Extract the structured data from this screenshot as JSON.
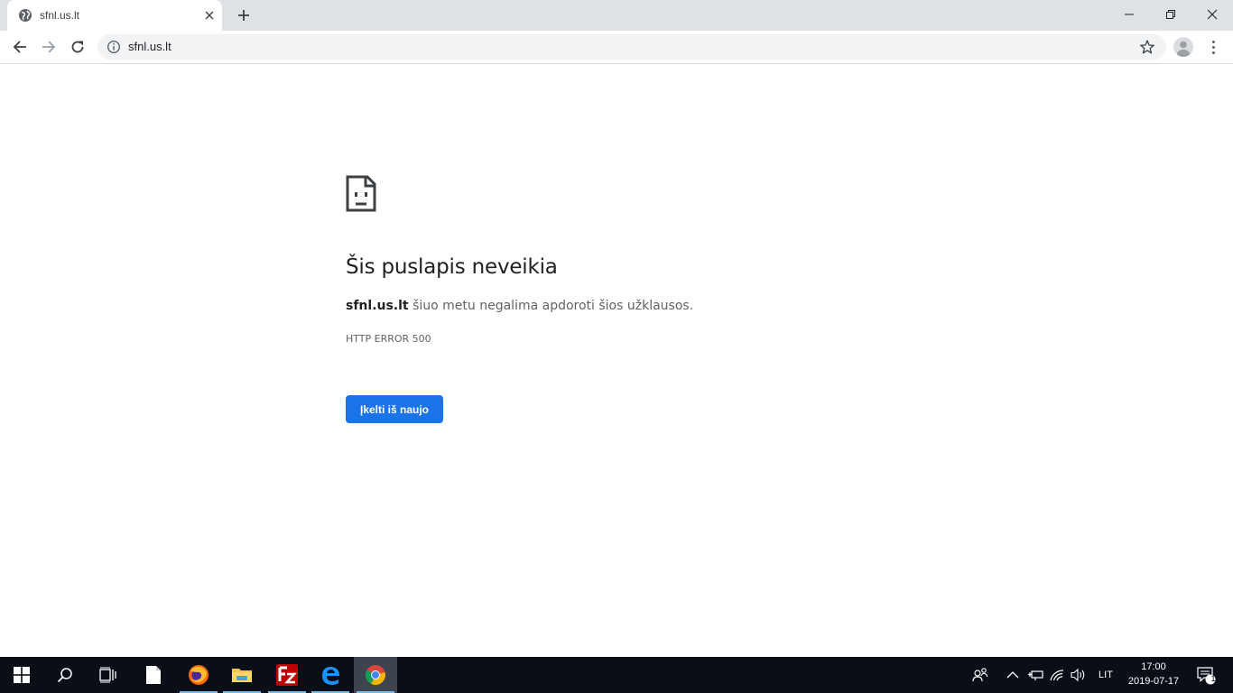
{
  "browser": {
    "tab": {
      "title": "sfnl.us.lt",
      "favicon": "globe-icon"
    },
    "omnibox": {
      "url": "sfnl.us.lt",
      "security_icon": "info-icon"
    }
  },
  "error_page": {
    "icon": "sad-page-icon",
    "title": "Šis puslapis neveikia",
    "description_host": "sfnl.us.lt",
    "description_rest": " šiuo metu negalima apdoroti šios užklausos.",
    "error_code": "HTTP ERROR 500",
    "reload_label": "Įkelti iš naujo"
  },
  "taskbar": {
    "pinned_apps": [
      "notepad",
      "firefox",
      "file-explorer",
      "filezilla",
      "edge",
      "chrome"
    ],
    "active_app": "chrome",
    "language": "LIT",
    "time": "17:00",
    "date": "2019-07-17",
    "notification_count": "1"
  },
  "colors": {
    "accent": "#1a73e8",
    "tabstrip": "#dee1e6",
    "taskbar": "#0a0f17"
  }
}
